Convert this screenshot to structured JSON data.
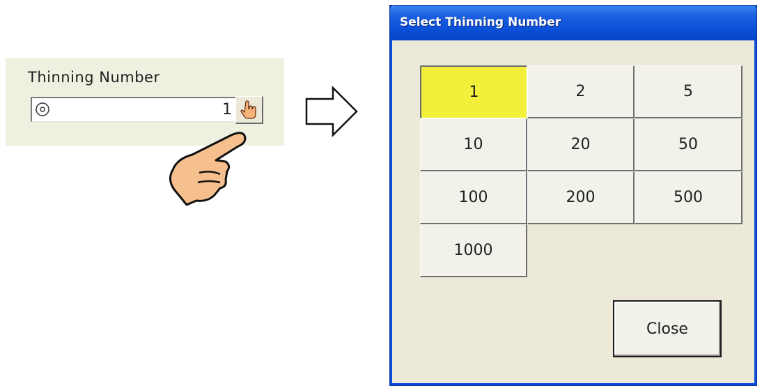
{
  "left_panel": {
    "label": "Thinning Number",
    "field_value": "1",
    "field_icon": "dial-icon",
    "picker_icon": "hand-pointer-icon"
  },
  "dialog": {
    "title": "Select Thinning Number",
    "options": [
      "1",
      "2",
      "5",
      "10",
      "20",
      "50",
      "100",
      "200",
      "500",
      "1000"
    ],
    "selected": "1",
    "close_label": "Close"
  },
  "colors": {
    "titlebar": "#0a4fd8",
    "selected": "#f2f03a",
    "panel_bg": "#eef0e0",
    "dialog_bg": "#ece9d8"
  }
}
